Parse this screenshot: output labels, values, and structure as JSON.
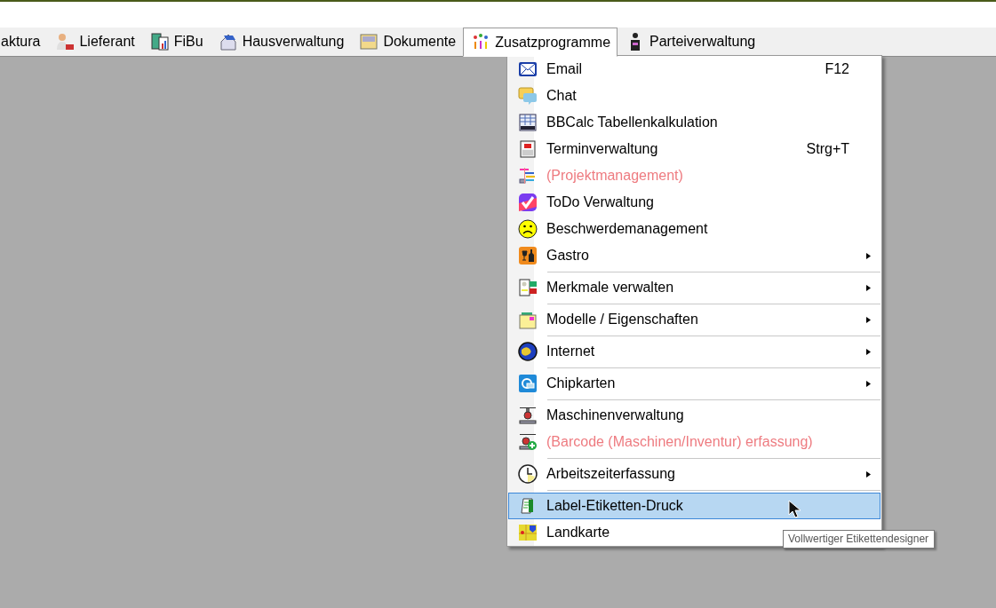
{
  "menubar": [
    {
      "label": "aktura",
      "open": false
    },
    {
      "label": "Lieferant",
      "open": false
    },
    {
      "label": "FiBu",
      "open": false
    },
    {
      "label": "Hausverwaltung",
      "open": false
    },
    {
      "label": "Dokumente",
      "open": false
    },
    {
      "label": "Zusatzprogramme",
      "open": true
    },
    {
      "label": "Parteiverwaltung",
      "open": false
    }
  ],
  "menu": {
    "items": [
      {
        "kind": "item",
        "label": "Email",
        "shortcut": "F12",
        "disabled": false,
        "submenu": false,
        "selected": false
      },
      {
        "kind": "item",
        "label": "Chat",
        "disabled": false,
        "submenu": false,
        "selected": false
      },
      {
        "kind": "item",
        "label": "BBCalc Tabellenkalkulation",
        "disabled": false,
        "submenu": false,
        "selected": false
      },
      {
        "kind": "item",
        "label": "Terminverwaltung",
        "shortcut": "Strg+T",
        "disabled": false,
        "submenu": false,
        "selected": false
      },
      {
        "kind": "item",
        "label": "(Projektmanagement)",
        "disabled": true,
        "submenu": false,
        "selected": false
      },
      {
        "kind": "item",
        "label": "ToDo Verwaltung",
        "disabled": false,
        "submenu": false,
        "selected": false
      },
      {
        "kind": "item",
        "label": "Beschwerdemanagement",
        "disabled": false,
        "submenu": false,
        "selected": false
      },
      {
        "kind": "item",
        "label": "Gastro",
        "disabled": false,
        "submenu": true,
        "selected": false
      },
      {
        "kind": "separator"
      },
      {
        "kind": "item",
        "label": "Merkmale verwalten",
        "disabled": false,
        "submenu": true,
        "selected": false
      },
      {
        "kind": "separator"
      },
      {
        "kind": "item",
        "label": "Modelle / Eigenschaften",
        "disabled": false,
        "submenu": true,
        "selected": false
      },
      {
        "kind": "separator"
      },
      {
        "kind": "item",
        "label": "Internet",
        "disabled": false,
        "submenu": true,
        "selected": false
      },
      {
        "kind": "separator"
      },
      {
        "kind": "item",
        "label": "Chipkarten",
        "disabled": false,
        "submenu": true,
        "selected": false
      },
      {
        "kind": "separator"
      },
      {
        "kind": "item",
        "label": "Maschinenverwaltung",
        "disabled": false,
        "submenu": false,
        "selected": false
      },
      {
        "kind": "item",
        "label": "(Barcode (Maschinen/Inventur) erfassung)",
        "disabled": true,
        "submenu": false,
        "selected": false
      },
      {
        "kind": "separator"
      },
      {
        "kind": "item",
        "label": "Arbeitszeiterfassung",
        "disabled": false,
        "submenu": true,
        "selected": false
      },
      {
        "kind": "separator"
      },
      {
        "kind": "item",
        "label": "Label-Etiketten-Druck",
        "disabled": false,
        "submenu": false,
        "selected": true
      },
      {
        "kind": "item",
        "label": "Landkarte",
        "disabled": false,
        "submenu": false,
        "selected": false
      }
    ]
  },
  "tooltip": "Vollwertiger Etikettendesigner"
}
